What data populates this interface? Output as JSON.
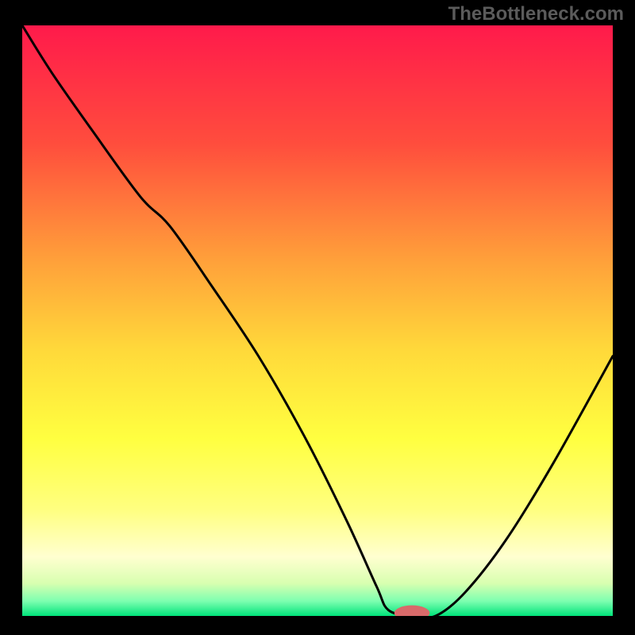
{
  "watermark": "TheBottleneck.com",
  "chart_data": {
    "type": "line",
    "title": "",
    "xlabel": "",
    "ylabel": "",
    "xlim": [
      0,
      100
    ],
    "ylim": [
      0,
      100
    ],
    "background_gradient_stops": [
      {
        "offset": 0.0,
        "color": "#ff1a4b"
      },
      {
        "offset": 0.2,
        "color": "#ff4d3d"
      },
      {
        "offset": 0.4,
        "color": "#ffa13a"
      },
      {
        "offset": 0.55,
        "color": "#ffd93a"
      },
      {
        "offset": 0.7,
        "color": "#ffff40"
      },
      {
        "offset": 0.82,
        "color": "#ffff80"
      },
      {
        "offset": 0.9,
        "color": "#ffffd0"
      },
      {
        "offset": 0.945,
        "color": "#d8ffb0"
      },
      {
        "offset": 0.975,
        "color": "#7dffb0"
      },
      {
        "offset": 1.0,
        "color": "#00e37a"
      }
    ],
    "curve": {
      "name": "bottleneck-curve",
      "x": [
        0,
        5,
        12,
        20,
        25,
        32,
        40,
        48,
        55,
        60,
        62,
        66,
        70,
        75,
        82,
        90,
        100
      ],
      "y": [
        100,
        92,
        82,
        71,
        66,
        56,
        44,
        30,
        16,
        5,
        1,
        0,
        0,
        4,
        13,
        26,
        44
      ]
    },
    "optimal_marker": {
      "x": 66,
      "y": 0.5,
      "rx": 3,
      "ry": 1.3,
      "color": "#d86a6a"
    }
  }
}
